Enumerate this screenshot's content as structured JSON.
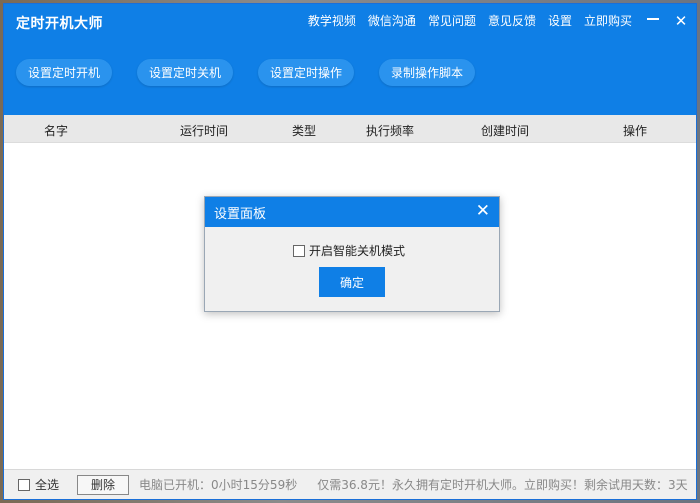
{
  "app": {
    "title": "定时开机大师"
  },
  "top_menu": [
    "教学视频",
    "微信沟通",
    "常见问题",
    "意见反馈",
    "设置",
    "立即购买"
  ],
  "window_controls": {
    "minimize": "minimize-icon",
    "close": "close-icon",
    "close_glyph": "✕"
  },
  "toolbar": [
    "设置定时开机",
    "设置定时关机",
    "设置定时操作",
    "录制操作脚本"
  ],
  "table": {
    "columns": [
      "名字",
      "运行时间",
      "类型",
      "执行频率",
      "创建时间",
      "操作"
    ],
    "rows": []
  },
  "dialog": {
    "title": "设置面板",
    "option_label": "开启智能关机模式",
    "option_checked": false,
    "ok_label": "确定",
    "close_glyph": "✕"
  },
  "footer": {
    "select_all": "全选",
    "delete_label": "删除",
    "uptime": "电脑已开机：0小时15分59秒",
    "promo": "仅需36.8元！永久拥有定时开机大师。立即购买！剩余试用天数：3天"
  },
  "colors": {
    "brand_blue": "#0f7fe6",
    "button_blue": "#2a93ee"
  }
}
